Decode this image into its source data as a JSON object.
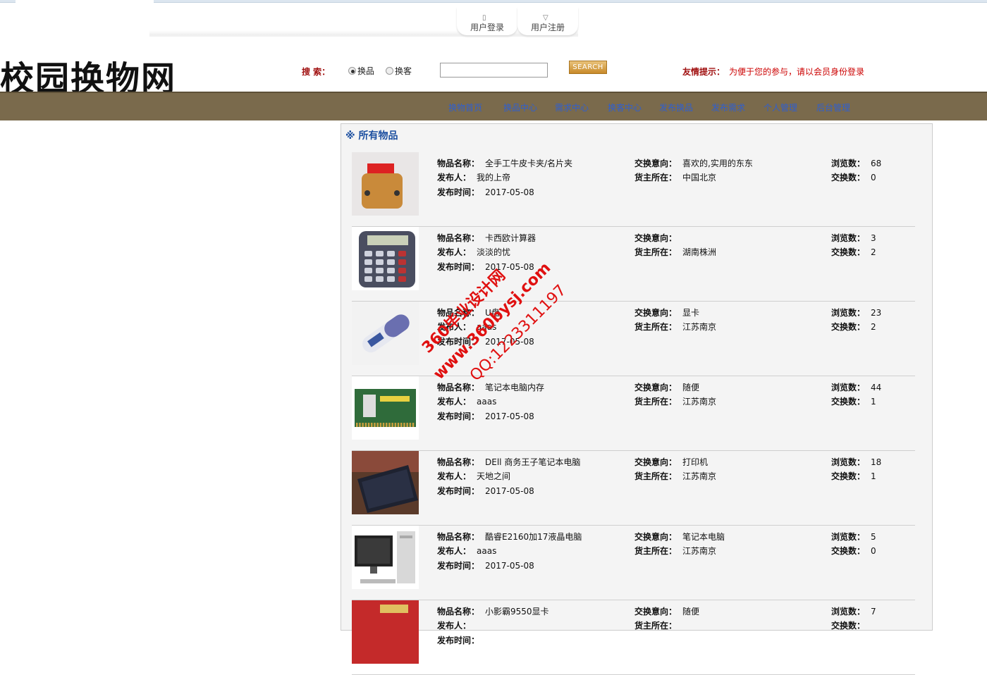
{
  "header": {
    "login": "用户登录",
    "register": "用户注册",
    "logo": "校园换物网",
    "search_label": "搜 索：",
    "radio_goods": "换品",
    "radio_guest": "换客",
    "search_value": "",
    "search_button": "SEARCH",
    "tip_label": "友情提示：",
    "tip_text": "为便于您的参与，请以会员身份登录"
  },
  "nav": [
    "换物首页",
    "换品中心",
    "需求中心",
    "换客中心",
    "发布换品",
    "发布需求",
    "个人管理",
    "后台管理"
  ],
  "section_title": "※ 所有物品",
  "labels": {
    "name": "物品名称：",
    "publisher": "发布人：",
    "time": "发布时间：",
    "intent": "交换意向：",
    "location": "货主所在：",
    "views": "浏览数：",
    "exchanges": "交换数："
  },
  "items": [
    {
      "name": "全手工牛皮卡夹/名片夹",
      "publisher": "我的上帝",
      "time": "2017-05-08",
      "intent": "喜欢的,实用的东东",
      "location": "中国北京",
      "views": "68",
      "exchanges": "0",
      "thumb": "wallet"
    },
    {
      "name": "卡西欧计算器",
      "publisher": "淡淡的忧",
      "time": "2017-05-08",
      "intent": "",
      "location": "湖南株洲",
      "views": "3",
      "exchanges": "2",
      "thumb": "calculator"
    },
    {
      "name": "U盘",
      "publisher": "aaas",
      "time": "2017-05-08",
      "intent": "显卡",
      "location": "江苏南京",
      "views": "23",
      "exchanges": "2",
      "thumb": "usb"
    },
    {
      "name": "笔记本电脑内存",
      "publisher": "aaas",
      "time": "2017-05-08",
      "intent": "随便",
      "location": "江苏南京",
      "views": "44",
      "exchanges": "1",
      "thumb": "ram"
    },
    {
      "name": "DEll 商务王子笔记本电脑",
      "publisher": "天地之间",
      "time": "2017-05-08",
      "intent": "打印机",
      "location": "江苏南京",
      "views": "18",
      "exchanges": "1",
      "thumb": "laptop"
    },
    {
      "name": "酷睿E2160加17液晶电脑",
      "publisher": "aaas",
      "time": "2017-05-08",
      "intent": "笔记本电脑",
      "location": "江苏南京",
      "views": "5",
      "exchanges": "0",
      "thumb": "desktop"
    },
    {
      "name": "小影霸9550显卡",
      "publisher": "",
      "time": "",
      "intent": "随便",
      "location": "",
      "views": "7",
      "exchanges": "",
      "thumb": "gpu"
    }
  ],
  "watermark": [
    "360毕业设计网",
    "www.360bysj.com",
    "QQ:1223311197"
  ]
}
